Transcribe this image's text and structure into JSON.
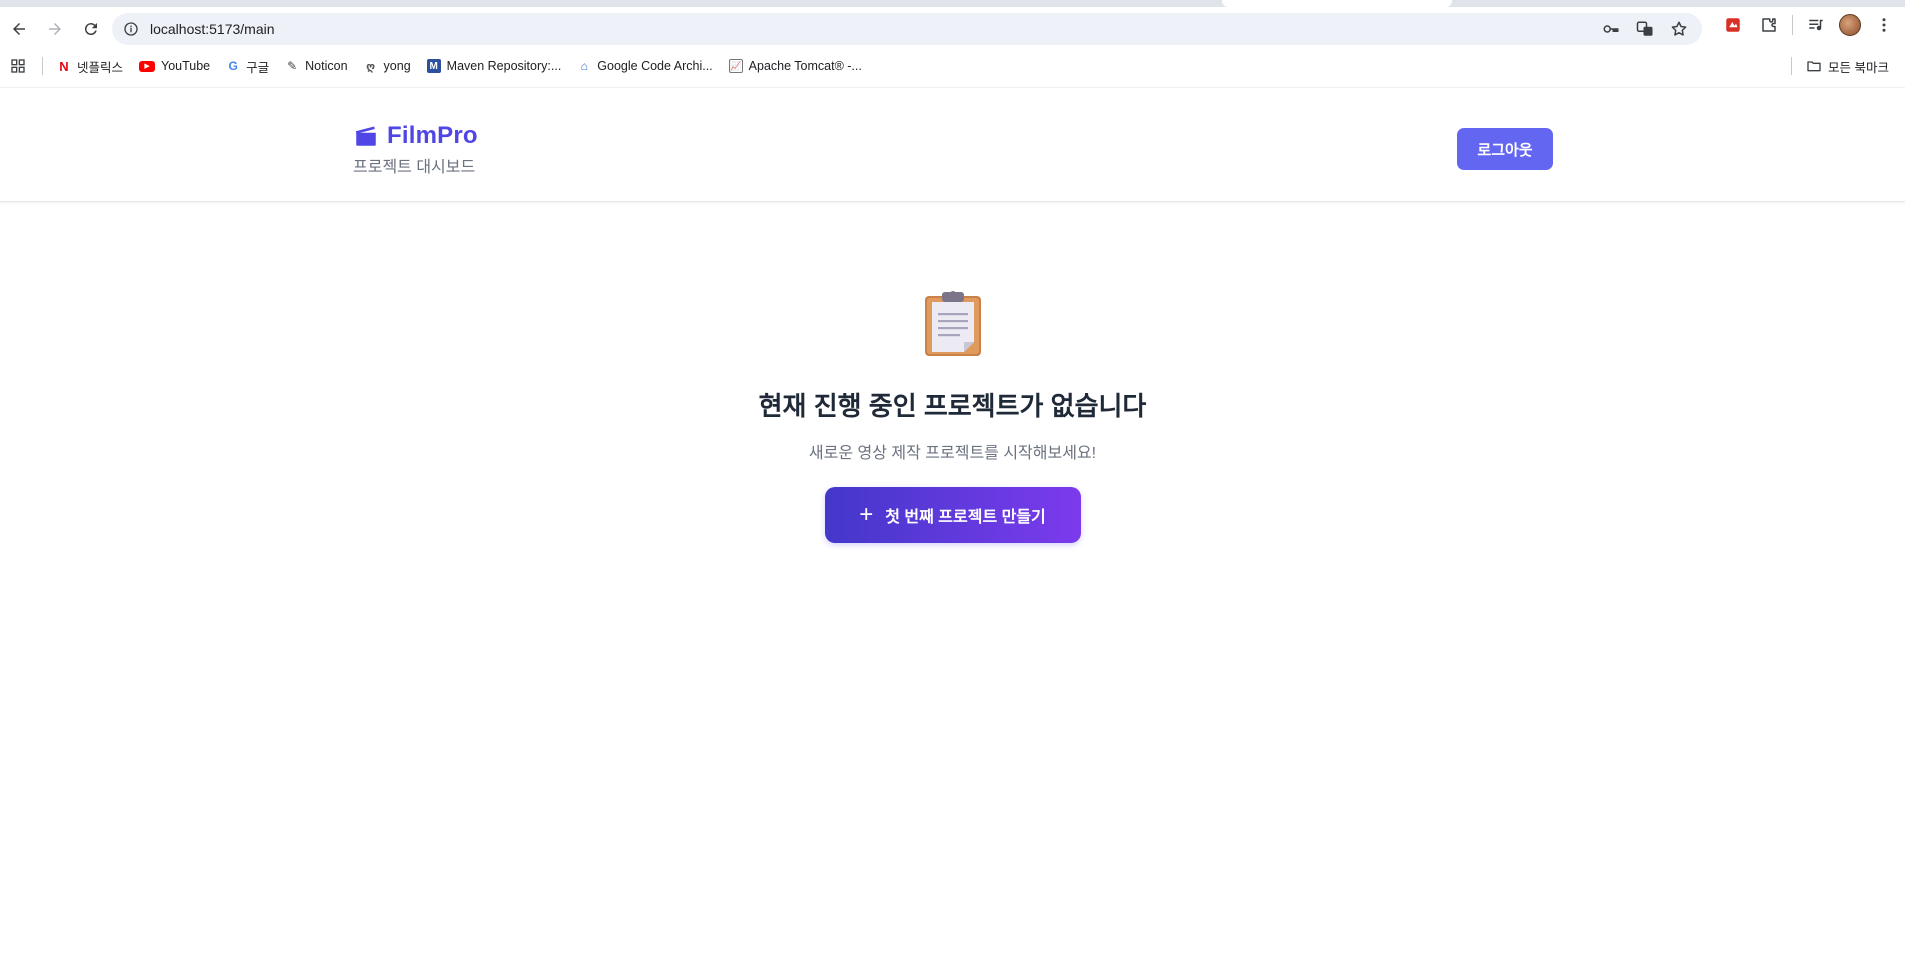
{
  "browser": {
    "url": "localhost:5173/main",
    "bookmarks": [
      {
        "label": "넷플릭스",
        "icon": "netflix-icon"
      },
      {
        "label": "YouTube",
        "icon": "youtube-icon"
      },
      {
        "label": "구글",
        "icon": "google-icon"
      },
      {
        "label": "Noticon",
        "icon": "noticon-icon"
      },
      {
        "label": "yong",
        "icon": "yong-icon"
      },
      {
        "label": "Maven Repository:...",
        "icon": "maven-icon"
      },
      {
        "label": "Google Code Archi...",
        "icon": "google-code-icon"
      },
      {
        "label": "Apache Tomcat® -...",
        "icon": "tomcat-icon"
      }
    ],
    "all_bookmarks_label": "모든 북마크"
  },
  "header": {
    "brand": "FilmPro",
    "subtitle": "프로젝트 대시보드",
    "logout_label": "로그아웃"
  },
  "empty_state": {
    "icon": "clipboard-icon",
    "title": "현재 진행 중인 프로젝트가 없습니다",
    "subtitle": "새로운 영상 제작 프로젝트를 시작해보세요!",
    "button_icon": "+",
    "button_label": "첫 번째 프로젝트 만들기"
  },
  "colors": {
    "brand": "#4f46e5",
    "logout_button": "#6366f1",
    "cta_gradient_start": "#4338ca",
    "cta_gradient_end": "#7c3aed"
  }
}
